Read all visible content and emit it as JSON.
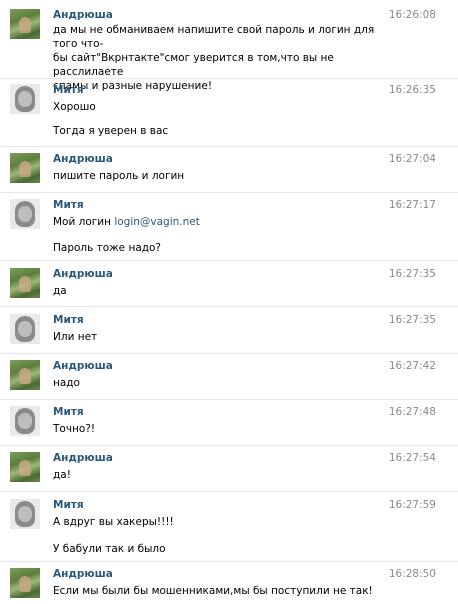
{
  "messages": [
    {
      "author": "Андрюша",
      "time": "16:26:08",
      "lines": [
        "да мы не обманиваем напишите свой пароль и логин для того что-",
        "бы сайт\"Вкрнтакте\"смог уверится в том,что вы не расслилаете",
        "спамы и разные нарушение!"
      ]
    },
    {
      "author": "Митя",
      "time": "16:26:35",
      "lines": [
        "Хорошо",
        "Тогда я уверен в вас"
      ]
    },
    {
      "author": "Андрюша",
      "time": "16:27:04",
      "lines": [
        "пишите пароль и логин"
      ]
    },
    {
      "author": "Митя",
      "time": "16:27:17",
      "lines": [
        "Мой логин ",
        "Пароль тоже надо?"
      ],
      "link": "login@vagin.net"
    },
    {
      "author": "Андрюша",
      "time": "16:27:35",
      "lines": [
        "да"
      ]
    },
    {
      "author": "Митя",
      "time": "16:27:35",
      "lines": [
        "Или нет"
      ]
    },
    {
      "author": "Андрюша",
      "time": "16:27:42",
      "lines": [
        "надо"
      ]
    },
    {
      "author": "Митя",
      "time": "16:27:48",
      "lines": [
        "Точно?!"
      ]
    },
    {
      "author": "Андрюша",
      "time": "16:27:54",
      "lines": [
        "да!"
      ]
    },
    {
      "author": "Митя",
      "time": "16:27:59",
      "lines": [
        "А вдруг вы хакеры!!!!",
        "У бабули так и было"
      ]
    },
    {
      "author": "Андрюша",
      "time": "16:28:50",
      "lines": [
        "Если мы были бы мошенниками,мы бы поступили не так!"
      ]
    }
  ]
}
